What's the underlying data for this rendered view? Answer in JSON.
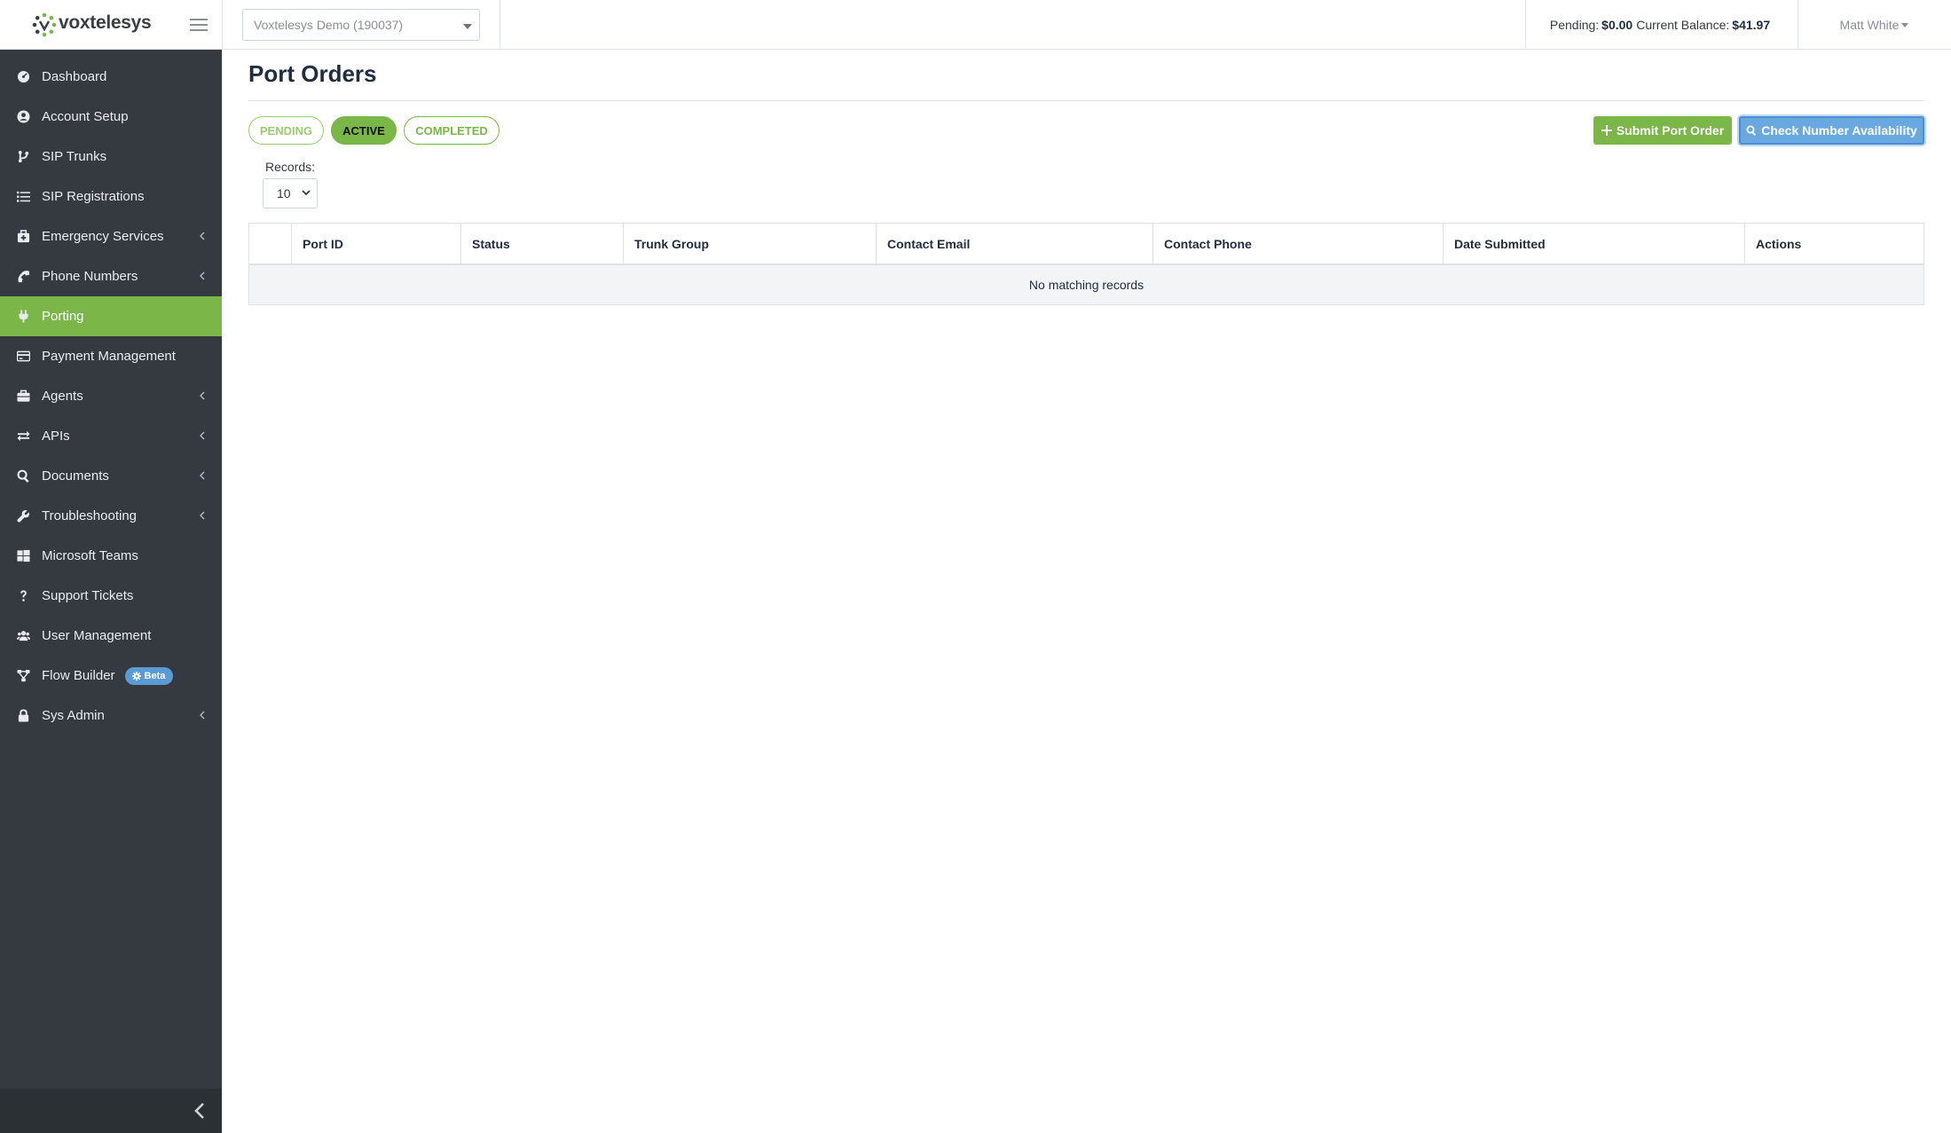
{
  "brand": {
    "name": "voxtelesys",
    "logo_color": "#7ab648"
  },
  "header": {
    "account_selector": "Voxtelesys Demo (190037)",
    "pending_label": "Pending:",
    "pending_value": "$0.00",
    "balance_label": "Current Balance:",
    "balance_value": "$41.97",
    "user_name": "Matt White"
  },
  "sidebar": {
    "items": [
      {
        "label": "Dashboard",
        "icon": "dashboard-icon",
        "has_submenu": false
      },
      {
        "label": "Account Setup",
        "icon": "user-circle-icon",
        "has_submenu": false
      },
      {
        "label": "SIP Trunks",
        "icon": "code-branch-icon",
        "has_submenu": false
      },
      {
        "label": "SIP Registrations",
        "icon": "list-icon",
        "has_submenu": false
      },
      {
        "label": "Emergency Services",
        "icon": "medkit-icon",
        "has_submenu": true
      },
      {
        "label": "Phone Numbers",
        "icon": "phone-icon",
        "has_submenu": true
      },
      {
        "label": "Porting",
        "icon": "plug-icon",
        "has_submenu": false,
        "active": true
      },
      {
        "label": "Payment Management",
        "icon": "credit-card-icon",
        "has_submenu": false
      },
      {
        "label": "Agents",
        "icon": "briefcase-icon",
        "has_submenu": true
      },
      {
        "label": "APIs",
        "icon": "exchange-icon",
        "has_submenu": true
      },
      {
        "label": "Documents",
        "icon": "search-icon",
        "has_submenu": true
      },
      {
        "label": "Troubleshooting",
        "icon": "wrench-icon",
        "has_submenu": true
      },
      {
        "label": "Microsoft Teams",
        "icon": "windows-icon",
        "has_submenu": false
      },
      {
        "label": "Support Tickets",
        "icon": "question-icon",
        "has_submenu": false
      },
      {
        "label": "User Management",
        "icon": "users-icon",
        "has_submenu": false
      },
      {
        "label": "Flow Builder",
        "icon": "flow-icon",
        "has_submenu": false,
        "badge": "Beta"
      },
      {
        "label": "Sys Admin",
        "icon": "lock-icon",
        "has_submenu": true
      }
    ],
    "active_color": "#7ab648",
    "badge_color": "#5b9bd5"
  },
  "main": {
    "title": "Port Orders",
    "filters": [
      {
        "label": "PENDING"
      },
      {
        "label": "ACTIVE",
        "selected": true
      },
      {
        "label": "COMPLETED"
      }
    ],
    "buttons": {
      "submit": "Submit Port Order",
      "check": "Check Number Availability"
    },
    "records_label": "Records:",
    "records_value": "10",
    "table": {
      "columns": [
        "",
        "Port ID",
        "Status",
        "Trunk Group",
        "Contact Email",
        "Contact Phone",
        "Date Submitted",
        "Actions"
      ],
      "empty_message": "No matching records"
    }
  }
}
